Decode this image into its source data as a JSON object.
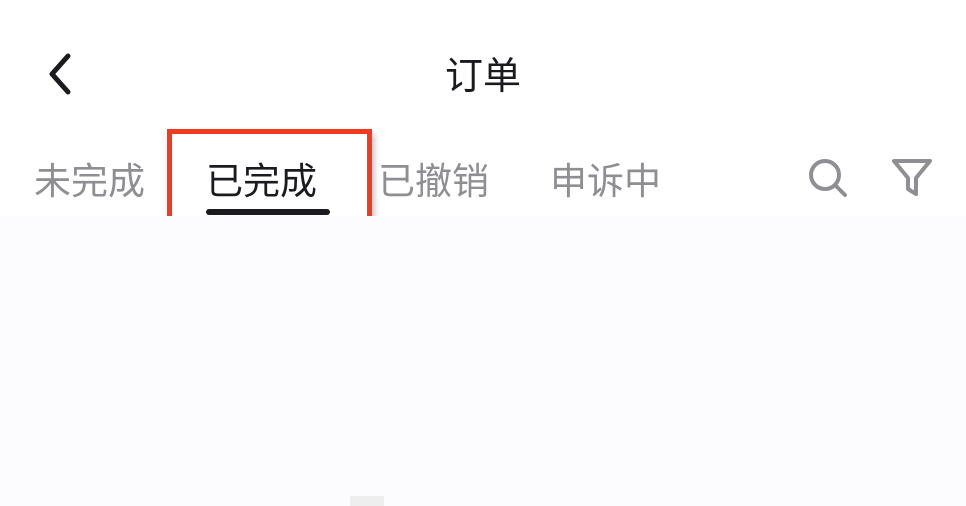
{
  "header": {
    "title": "订单",
    "back_icon": "chevron-left-icon"
  },
  "tabs": [
    {
      "label": "未完成",
      "active": false
    },
    {
      "label": "已完成",
      "active": true
    },
    {
      "label": "已撤销",
      "active": false
    },
    {
      "label": "申诉中",
      "active": false
    }
  ],
  "actions": {
    "search_icon": "search-icon",
    "filter_icon": "filter-icon"
  },
  "colors": {
    "text_primary": "#1b1b1f",
    "text_secondary": "#8e8e93",
    "highlight": "#f23a1f",
    "content_bg": "#fcfbfd"
  }
}
